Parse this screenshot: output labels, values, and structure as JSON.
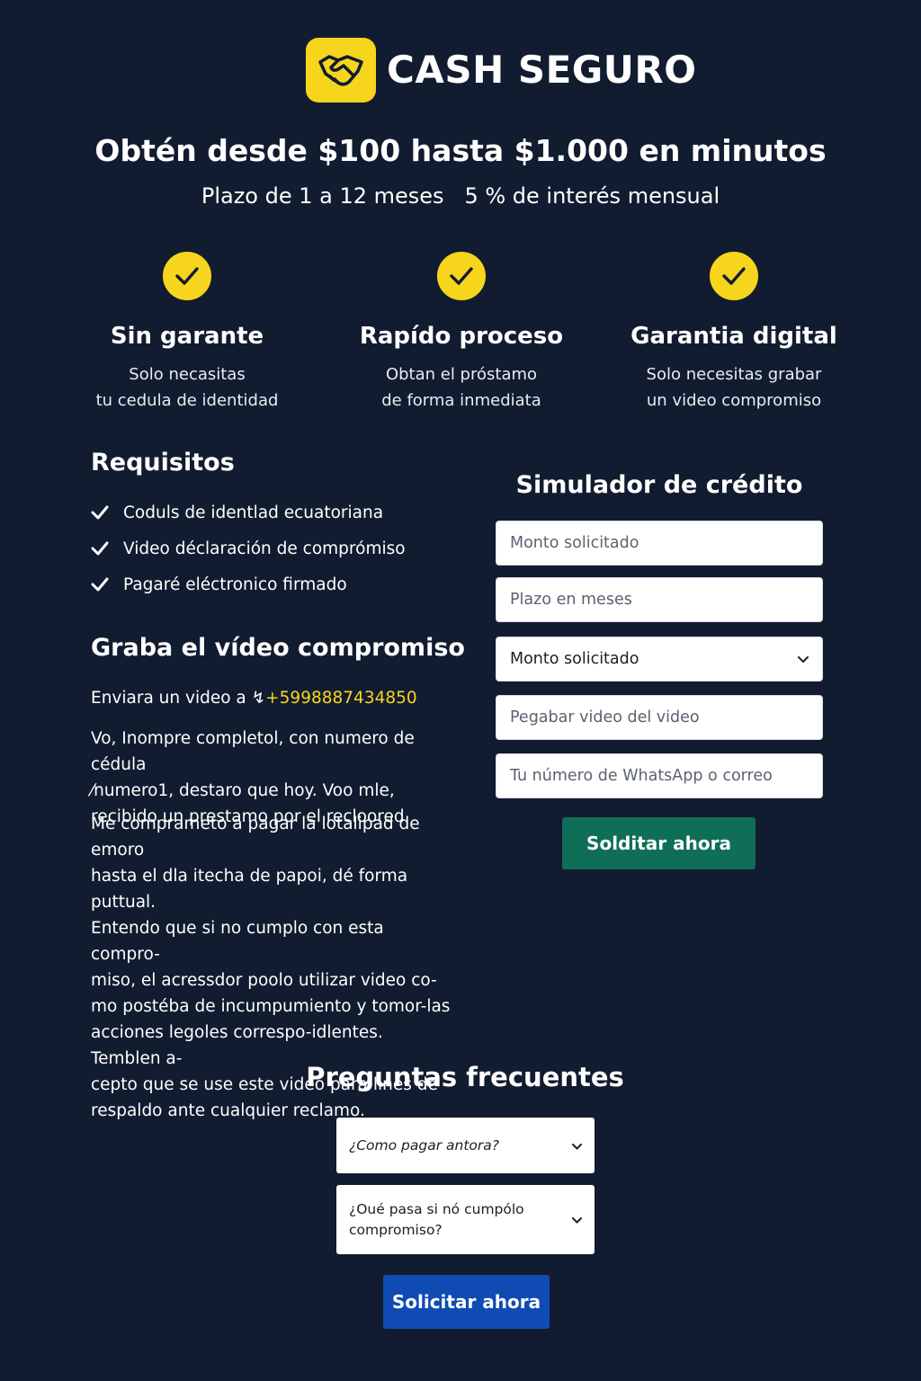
{
  "brand": {
    "name": "CASH SEGURO",
    "logo_icon": "handshake-icon",
    "accent_color": "#f7d51d",
    "background_color": "#121c30"
  },
  "hero": {
    "headline": "Obtén desde $100 hasta $1.000 en minutos",
    "subline": "Plazo de 1 a 12 meses   5 % de interés mensual"
  },
  "features": [
    {
      "icon": "check-circle-icon",
      "title": "Sin garante",
      "line1": "Solo necasitas",
      "line2": "tu cedula de identidad"
    },
    {
      "icon": "check-circle-icon",
      "title": "Rapído proceso",
      "line1": "Obtan el próstamo",
      "line2": "de forma inmediata"
    },
    {
      "icon": "check-circle-icon",
      "title": "Garantia digital",
      "line1": "Solo necesitas grabar",
      "line2": "un video compromiso"
    }
  ],
  "requirements": {
    "title": "Requisitos",
    "items": [
      "Coduls de identlad ecuatoriana",
      "Video déclaración de comprómiso",
      "Pagaré eléctronico firmado"
    ]
  },
  "video": {
    "title": "Graba el vídeo compromiso",
    "send_prefix": "Enviara un video a",
    "phone_marker": "↯",
    "phone": "+5998887434850",
    "paragraph1": [
      "Vo, Inompre completol, con numero de cédula",
      "⁄numero1, destaro que hoy. Voo mle,",
      "recibido un prestamo por el recloored"
    ],
    "paragraph2": [
      "Me comprameto a pagar la lotalipad de emoro",
      "hasta el dla itecha de papoi, dé forma puttual.",
      "Entendo que si no cumplo con esta compro-",
      "miso, el acressdor poolo utilizar video co-",
      "mo postéba de incumpumiento y tomor-las",
      "acciones legoles correspo-idlentes. Temblen a-",
      "cepto que se use este video para lines de",
      "respaldo ante cualquier reclamo."
    ]
  },
  "simulator": {
    "title": "Simulador de crédito",
    "amount_placeholder": "Monto solicitado",
    "term_placeholder": "Plazo en meses",
    "select_value": "Monto solicitado",
    "video_placeholder": "Pegabar video del  video",
    "contact_placeholder": "Tu número de WhatsApp o correo",
    "submit_label": "Solditar ahora",
    "submit_color": "#0f6e58"
  },
  "faq": {
    "title": "Preguntas frecuentes",
    "items": [
      "¿Como pagar antora?",
      "¿Oué pasa si nó cumpólo compromiso?"
    ],
    "cta_label": "Solicitar ahora",
    "cta_color": "#0f4bb3"
  }
}
